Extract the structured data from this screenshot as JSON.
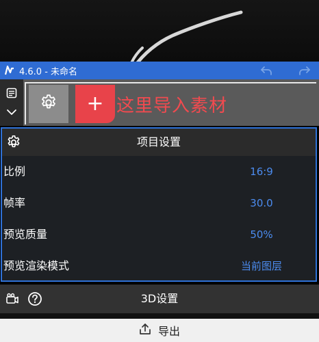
{
  "app": {
    "title": "4.6.0 - 未命名"
  },
  "toolbar": {
    "add_label": "+",
    "hint": "这里导入素材"
  },
  "panel": {
    "title": "项目设置",
    "rows": [
      {
        "label": "比例",
        "value": "16:9"
      },
      {
        "label": "帧率",
        "value": "30.0"
      },
      {
        "label": "预览质量",
        "value": "50%"
      },
      {
        "label": "预览渲染模式",
        "value": "当前图层"
      }
    ]
  },
  "bottom_bar": {
    "title": "3D设置"
  },
  "export": {
    "label": "导出"
  },
  "colors": {
    "accent": "#2f6cd3",
    "add_button": "#e8434a",
    "hint_text": "#f24a4f",
    "value_text": "#4c8cf0"
  },
  "icons": {
    "logo": "app-logo-icon",
    "undo": "undo-icon",
    "redo": "redo-icon",
    "menu": "document-icon",
    "chevron": "chevron-down-icon",
    "settings": "gear-icon",
    "camera": "camera-icon",
    "help": "help-icon",
    "export": "export-icon"
  }
}
